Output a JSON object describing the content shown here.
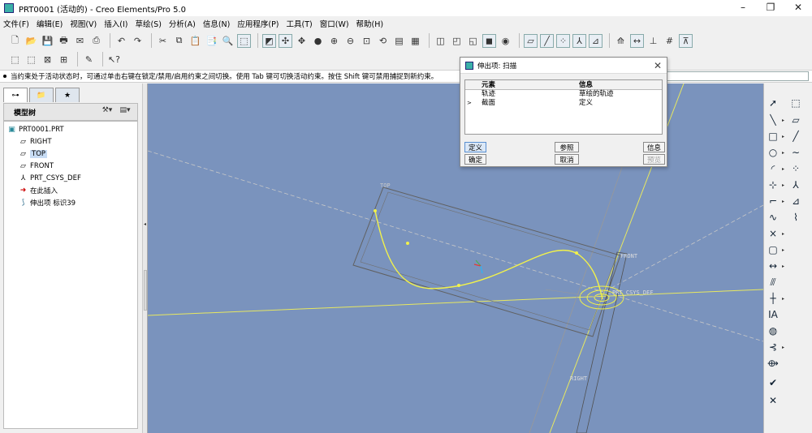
{
  "window": {
    "title": "PRT0001 (活动的) - Creo Elements/Pro 5.0",
    "controls": [
      "–",
      "❐",
      "✕"
    ]
  },
  "menu": [
    "文件(F)",
    "编辑(E)",
    "视图(V)",
    "插入(I)",
    "草绘(S)",
    "分析(A)",
    "信息(N)",
    "应用程序(P)",
    "工具(T)",
    "窗口(W)",
    "帮助(H)"
  ],
  "status_message": "当约束处于活动状态时，可通过单击右键在锁定/禁用/启用约束之间切换。使用 Tab 键可切换活动约束。按住 Shift 键可禁用捕捉到新约束。",
  "model_tree": {
    "header": "模型树",
    "items": [
      {
        "label": "PRT0001.PRT",
        "icon": "part-icon"
      },
      {
        "label": "RIGHT",
        "icon": "datum-plane-icon"
      },
      {
        "label": "TOP",
        "icon": "datum-plane-icon",
        "selected": true
      },
      {
        "label": "FRONT",
        "icon": "datum-plane-icon"
      },
      {
        "label": "PRT_CSYS_DEF",
        "icon": "csys-icon"
      },
      {
        "label": "在此插入",
        "icon": "insert-here-icon"
      },
      {
        "label": "伸出项 标识39",
        "icon": "protrusion-icon"
      }
    ]
  },
  "dialog": {
    "title": "伸出项: 扫描",
    "col_element": "元素",
    "col_info": "信息",
    "rows": [
      {
        "marker": "",
        "element": "轨迹",
        "info": "草绘的轨迹"
      },
      {
        "marker": ">",
        "element": "截面",
        "info": "定义"
      }
    ],
    "buttons": {
      "define": "定义",
      "refs": "参照",
      "info": "信息",
      "ok": "确定",
      "cancel": "取消",
      "preview": "预览"
    }
  },
  "graphics": {
    "background_color": "#7a93bd",
    "labels": {
      "top": "TOP",
      "front": "FRONT",
      "right": "RIGHT",
      "csys": "PRT_CSYS_DEF"
    }
  },
  "colors": {
    "curve": "#f2f24a",
    "datum_plane": "#d8d860",
    "selection": "#c7dcf4"
  }
}
